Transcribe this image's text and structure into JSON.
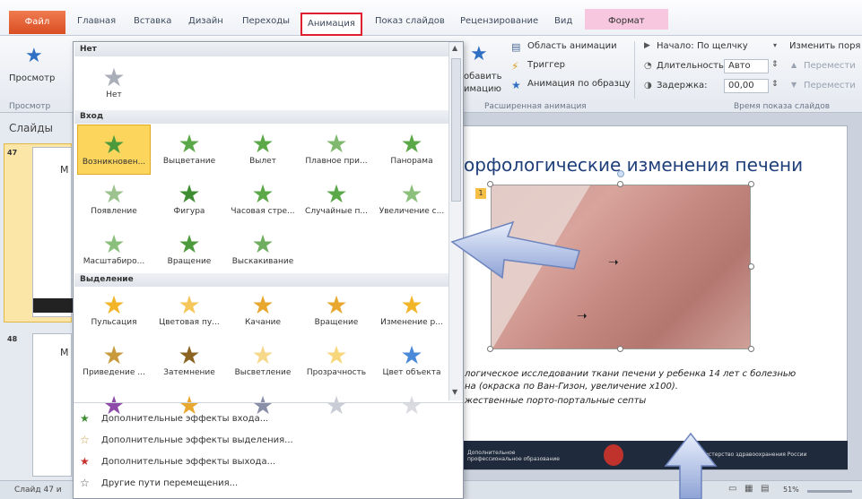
{
  "tabs": {
    "file": "Файл",
    "items": [
      "Главная",
      "Вставка",
      "Дизайн",
      "Переходы",
      "Анимация",
      "Показ слайдов",
      "Рецензирование",
      "Вид",
      "Формат"
    ],
    "active_index": 4
  },
  "ribbon": {
    "preview_label": "Просмотр",
    "preview_group": "Просмотр",
    "add_anim_label_1": "обавить",
    "add_anim_label_2": "имацию",
    "anim_pane": "Область анимации",
    "trigger": "Триггер",
    "anim_painter": "Анимация по образцу",
    "ext_anim_group": "Расширенная анимация",
    "start_label": "Начало:",
    "start_value": "По щелчку",
    "duration_label": "Длительность:",
    "duration_value": "Авто",
    "delay_label": "Задержка:",
    "delay_value": "00,00",
    "timing_group": "Время показа слайдов",
    "reorder_label": "Изменить поря",
    "move_earlier": "Перемести",
    "move_later": "Перемести"
  },
  "slides_pane": {
    "tab_label": "Слайды",
    "thumbs": [
      {
        "number": "47",
        "text": "М"
      },
      {
        "number": "48",
        "text": "М"
      }
    ]
  },
  "gallery": {
    "sections": [
      {
        "title": "Нет",
        "items": [
          {
            "label": "Нет",
            "color": "#a9aeb8"
          }
        ]
      },
      {
        "title": "Вход",
        "items": [
          {
            "label": "Возникновен...",
            "color": "#4c9a3c",
            "selected": true
          },
          {
            "label": "Выцветание",
            "color": "#5aa848"
          },
          {
            "label": "Вылет",
            "color": "#5aa848"
          },
          {
            "label": "Плавное при...",
            "color": "#7fb86e"
          },
          {
            "label": "Панорама",
            "color": "#5aa848"
          },
          {
            "label": "Появление",
            "color": "#9cc38f"
          },
          {
            "label": "Фигура",
            "color": "#3f8d32"
          },
          {
            "label": "Часовая стре...",
            "color": "#5aa848"
          },
          {
            "label": "Случайные п...",
            "color": "#5aa848"
          },
          {
            "label": "Увеличение с...",
            "color": "#8bbf7c"
          },
          {
            "label": "Масштабиро...",
            "color": "#8bbf7c"
          },
          {
            "label": "Вращение",
            "color": "#4c9a3c"
          },
          {
            "label": "Выскакивание",
            "color": "#6eae5e"
          }
        ]
      },
      {
        "title": "Выделение",
        "items": [
          {
            "label": "Пульсация",
            "color": "#f2b428"
          },
          {
            "label": "Цветовая пу...",
            "color": "#f5c65a"
          },
          {
            "label": "Качание",
            "color": "#e8a830"
          },
          {
            "label": "Вращение",
            "color": "#e8a830"
          },
          {
            "label": "Изменение р...",
            "color": "#f2b428"
          },
          {
            "label": "Приведение ...",
            "color": "#c99a3c"
          },
          {
            "label": "Затемнение",
            "color": "#8a6420"
          },
          {
            "label": "Высветление",
            "color": "#f5d88a"
          },
          {
            "label": "Прозрачность",
            "color": "#f7d67c"
          },
          {
            "label": "Цвет объекта",
            "color": "#4a8ad8"
          },
          {
            "label": "",
            "color": "#8e4aa8"
          },
          {
            "label": "",
            "color": "#e8a830"
          },
          {
            "label": "",
            "color": "#8a8fa8"
          },
          {
            "label": "",
            "color": "#c9ccd4"
          },
          {
            "label": "",
            "color": "#d9dbe0"
          }
        ]
      }
    ],
    "more_effects": [
      {
        "icon": "★",
        "color": "#3f8d32",
        "label": "Дополнительные эффекты входа..."
      },
      {
        "icon": "☆",
        "color": "#c99a3c",
        "label": "Дополнительные эффекты выделения..."
      },
      {
        "icon": "★",
        "color": "#c9302c",
        "label": "Дополнительные эффекты выхода..."
      },
      {
        "icon": "☆",
        "color": "#555555",
        "label": "Другие пути перемещения..."
      }
    ]
  },
  "slide": {
    "title": "орфологические изменения печени",
    "badge": "1",
    "caption_lines": [
      "логическое исследовании ткани печени у ребенка 14 лет с болезнью",
      "на (окраска по Ван-Гизон, увеличение х100).",
      "жественные порто-портальные септы"
    ],
    "footer_left": "Дополнительное профессиональное образование",
    "footer_right": "Министерство здравоохранения России"
  },
  "status": {
    "slide_info": "Слайд 47 и",
    "zoom": "51%"
  }
}
